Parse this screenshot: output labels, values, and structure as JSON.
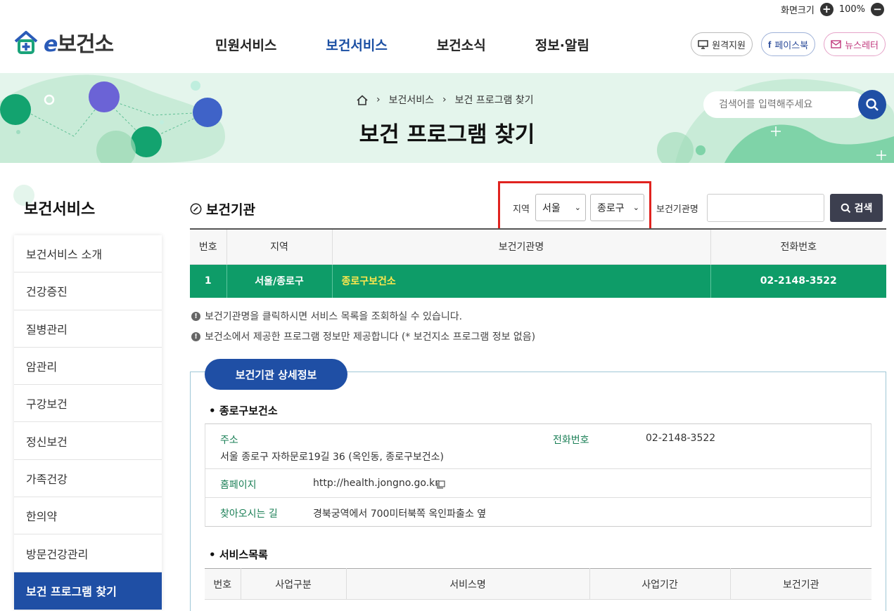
{
  "utility": {
    "screen_size_label": "화면크기",
    "zoom": "100%"
  },
  "header": {
    "logo_e": "e",
    "logo_text": "보건소",
    "nav": [
      "민원서비스",
      "보건서비스",
      "보건소식",
      "정보·알림"
    ],
    "active_nav": "보건서비스",
    "links": {
      "remote": "원격지원",
      "facebook": "페이스북",
      "newsletter": "뉴스레터"
    }
  },
  "banner": {
    "breadcrumb": [
      "보건서비스",
      "보건 프로그램 찾기"
    ],
    "title": "보건 프로그램 찾기",
    "search_placeholder": "검색어를 입력해주세요"
  },
  "sidebar": {
    "title": "보건서비스",
    "items": [
      "보건서비스 소개",
      "건강증진",
      "질병관리",
      "암관리",
      "구강보건",
      "정신보건",
      "가족건강",
      "한의약",
      "방문건강관리",
      "보건 프로그램 찾기"
    ],
    "active": "보건 프로그램 찾기"
  },
  "main": {
    "section_title": "보건기관",
    "filter": {
      "region_label": "지역",
      "city": "서울",
      "district": "종로구",
      "org_label": "보건기관명",
      "org_value": "",
      "search_button": "검색"
    },
    "table": {
      "headers": [
        "번호",
        "지역",
        "보건기관명",
        "전화번호"
      ],
      "rows": [
        {
          "no": "1",
          "region": "서울/종로구",
          "name": "종로구보건소",
          "phone": "02-2148-3522"
        }
      ]
    },
    "notes": [
      "보건기관명을 클릭하시면 서비스 목록을 조회하실 수 있습니다.",
      "보건소에서 제공한 프로그램 정보만 제공합니다 (* 보건지소 프로그램 정보 없음)"
    ]
  },
  "detail": {
    "tab_label": "보건기관 상세정보",
    "org_name": "종로구보건소",
    "address_label": "주소",
    "address": "서울 종로구 자하문로19길 36 (옥인동, 종로구보건소)",
    "phone_label": "전화번호",
    "phone": "02-2148-3522",
    "homepage_label": "홈페이지",
    "homepage": "http://health.jongno.go.kr",
    "directions_label": "찾아오시는 길",
    "directions": "경북궁역에서 700미터북쪽 옥인파출소 옆",
    "services_title": "서비스목록",
    "services_headers": [
      "번호",
      "사업구분",
      "서비스명",
      "사업기간",
      "보건기관"
    ]
  },
  "colors": {
    "brand_blue": "#1f4fa5",
    "green_row": "#0e9c68",
    "highlight_red": "#e0231f",
    "banner_bg": "#e4f5ec"
  }
}
